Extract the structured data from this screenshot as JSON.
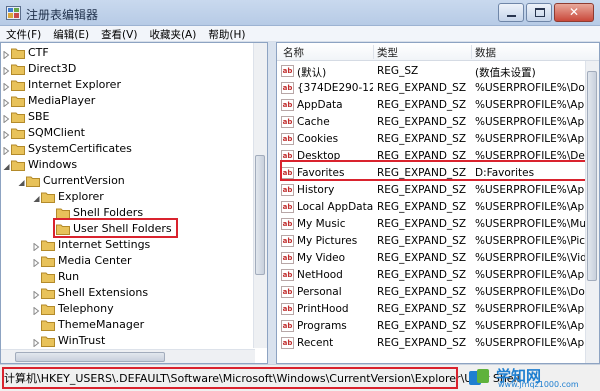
{
  "window": {
    "title": "注册表编辑器"
  },
  "menu": [
    "文件(F)",
    "编辑(E)",
    "查看(V)",
    "收藏夹(A)",
    "帮助(H)"
  ],
  "tree": {
    "items": [
      {
        "label": "CTF",
        "level": 0,
        "expander": "collapsed"
      },
      {
        "label": "Direct3D",
        "level": 0,
        "expander": "collapsed"
      },
      {
        "label": "Internet Explorer",
        "level": 0,
        "expander": "collapsed"
      },
      {
        "label": "MediaPlayer",
        "level": 0,
        "expander": "collapsed"
      },
      {
        "label": "SBE",
        "level": 0,
        "expander": "collapsed"
      },
      {
        "label": "SQMClient",
        "level": 0,
        "expander": "collapsed"
      },
      {
        "label": "SystemCertificates",
        "level": 0,
        "expander": "collapsed"
      },
      {
        "label": "Windows",
        "level": 0,
        "expander": "expanded"
      },
      {
        "label": "CurrentVersion",
        "level": 1,
        "expander": "expanded"
      },
      {
        "label": "Explorer",
        "level": 2,
        "expander": "expanded"
      },
      {
        "label": "Shell Folders",
        "level": 3,
        "expander": "none"
      },
      {
        "label": "User Shell Folders",
        "level": 3,
        "expander": "none",
        "selected": true
      },
      {
        "label": "Internet Settings",
        "level": 2,
        "expander": "collapsed"
      },
      {
        "label": "Media Center",
        "level": 2,
        "expander": "collapsed"
      },
      {
        "label": "Run",
        "level": 2,
        "expander": "none"
      },
      {
        "label": "Shell Extensions",
        "level": 2,
        "expander": "collapsed"
      },
      {
        "label": "Telephony",
        "level": 2,
        "expander": "collapsed"
      },
      {
        "label": "ThemeManager",
        "level": 2,
        "expander": "none"
      },
      {
        "label": "WinTrust",
        "level": 2,
        "expander": "collapsed"
      }
    ]
  },
  "list": {
    "columns": {
      "name": "名称",
      "type": "类型",
      "data": "数据"
    },
    "rows": [
      {
        "name": "(默认)",
        "type": "REG_SZ",
        "data": "(数值未设置)"
      },
      {
        "name": "{374DE290-12...",
        "type": "REG_EXPAND_SZ",
        "data": "%USERPROFILE%\\Dov"
      },
      {
        "name": "AppData",
        "type": "REG_EXPAND_SZ",
        "data": "%USERPROFILE%\\App"
      },
      {
        "name": "Cache",
        "type": "REG_EXPAND_SZ",
        "data": "%USERPROFILE%\\App"
      },
      {
        "name": "Cookies",
        "type": "REG_EXPAND_SZ",
        "data": "%USERPROFILE%\\App"
      },
      {
        "name": "Desktop",
        "type": "REG_EXPAND_SZ",
        "data": "%USERPROFILE%\\Des"
      },
      {
        "name": "Favorites",
        "type": "REG_EXPAND_SZ",
        "data": "D:Favorites",
        "highlighted": true
      },
      {
        "name": "History",
        "type": "REG_EXPAND_SZ",
        "data": "%USERPROFILE%\\App"
      },
      {
        "name": "Local AppData",
        "type": "REG_EXPAND_SZ",
        "data": "%USERPROFILE%\\App"
      },
      {
        "name": "My Music",
        "type": "REG_EXPAND_SZ",
        "data": "%USERPROFILE%\\Mus"
      },
      {
        "name": "My Pictures",
        "type": "REG_EXPAND_SZ",
        "data": "%USERPROFILE%\\Pictu"
      },
      {
        "name": "My Video",
        "type": "REG_EXPAND_SZ",
        "data": "%USERPROFILE%\\Vide"
      },
      {
        "name": "NetHood",
        "type": "REG_EXPAND_SZ",
        "data": "%USERPROFILE%\\App"
      },
      {
        "name": "Personal",
        "type": "REG_EXPAND_SZ",
        "data": "%USERPROFILE%\\Doc"
      },
      {
        "name": "PrintHood",
        "type": "REG_EXPAND_SZ",
        "data": "%USERPROFILE%\\App"
      },
      {
        "name": "Programs",
        "type": "REG_EXPAND_SZ",
        "data": "%USERPROFILE%\\App"
      },
      {
        "name": "Recent",
        "type": "REG_EXPAND_SZ",
        "data": "%USERPROFILE%\\App"
      }
    ]
  },
  "status": {
    "path": "计算机\\HKEY_USERS\\.DEFAULT\\Software\\Microsoft\\Windows\\CurrentVersion\\Explorer\\User Shell"
  },
  "watermark": {
    "title": "学知网",
    "url": "www.jmqz1000.com"
  },
  "colors": {
    "highlight": "#d9232e",
    "folder": "#e8c25a",
    "accent": "#1f7fd0"
  },
  "icons": {
    "folder": "folder-icon",
    "value": "string-value-icon",
    "app": "regedit-icon"
  }
}
